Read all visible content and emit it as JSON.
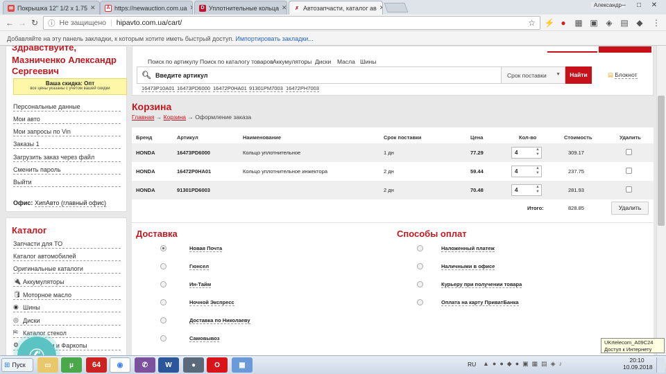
{
  "tabs": [
    {
      "title": "Покрышка 12\" 1/2 x 1.75",
      "icon": "mail-icon",
      "color": "#e04848"
    },
    {
      "title": "https://newauction.com.ua",
      "icon": "newauction-icon",
      "color": "#e03030"
    },
    {
      "title": "Уплотнительные кольца",
      "icon": "d-logo-icon",
      "color": "#c8102e"
    },
    {
      "title": "Автозапчасти, каталог ав",
      "icon": "hipavto-icon",
      "color": "#c8101a"
    }
  ],
  "window": {
    "user": "Александр"
  },
  "omnibox": {
    "security": "Не защищено",
    "url": "hipavto.com.ua/cart/"
  },
  "bookmarks_bar": {
    "text": "Добавляйте на эту панель закладки, к которым хотите иметь быстрый доступ.",
    "link": "Импортировать закладки..."
  },
  "sidebar": {
    "greeting": "Здравствуйте,",
    "user_name": "Мазниченко Александр Сергеевич",
    "discount_title": "Ваша скидка: Опт",
    "discount_note": "все цены указаны с учетом вашей скидки",
    "links": [
      "Персональные данные",
      "Мои авто",
      "Мои запросы по Vin",
      "Заказы 1",
      "Загрузить заказ через файл",
      "Сменить пароль",
      "Выйти"
    ],
    "office_label": "Офис:",
    "office_value": "ХипАвто (главный офис)"
  },
  "catalog": {
    "title": "Каталог",
    "items": [
      "Запчасти для ТО",
      "Каталог автомобилей",
      "Оригинальные каталоги",
      "Аккумуляторы",
      "Моторное масло",
      "Шины",
      "Диски",
      "Каталог стекол",
      "Глушители и Фаркопы"
    ]
  },
  "topnav": [
    "Поиск по артикулу",
    "Поиск по каталогу товаров",
    "Аккумуляторы",
    "Диски",
    "Масла",
    "Шины"
  ],
  "search": {
    "placeholder": "Введите артикул",
    "sort": "Срок поставки",
    "button": "Найти",
    "notepad": "Блокнот"
  },
  "recent_articles": [
    "16473P10A01",
    "16473PD6000",
    "16472P0HA01",
    "91301PM7003",
    "16472PH7003"
  ],
  "cart": {
    "title": "Корзина",
    "breadcrumb": {
      "home": "Главная",
      "sep1": "→",
      "cart": "Корзина",
      "sep2": "→",
      "current": "Оформление заказа"
    },
    "headers": {
      "brand": "Бренд",
      "article": "Артикул",
      "name": "Наименование",
      "delivery": "Срок поставки",
      "price": "Цена",
      "qty": "Кол-во",
      "cost": "Стоимость",
      "delete": "Удалить"
    },
    "rows": [
      {
        "brand": "HONDA",
        "article": "16473PD6000",
        "name": "Кольцо уплотнительное",
        "delivery": "1 дн",
        "price": "77.29",
        "qty": "4",
        "cost": "309.17"
      },
      {
        "brand": "HONDA",
        "article": "16472P0HA01",
        "name": "Кольцо уплотнительное инжектора",
        "delivery": "2 дн",
        "price": "59.44",
        "qty": "4",
        "cost": "237.75"
      },
      {
        "brand": "HONDA",
        "article": "91301PD6003",
        "name": "",
        "delivery": "2 дн",
        "price": "70.48",
        "qty": "4",
        "cost": "281.93"
      }
    ],
    "total_label": "Итого:",
    "total": "828.85",
    "delete_button": "Удалить"
  },
  "delivery": {
    "title": "Доставка",
    "options": [
      "Новая Почта",
      "Гюнсел",
      "Ин-Тайм",
      "Ночной Экспресс",
      "Доставка по Николаеву",
      "Самовывоз"
    ],
    "selected": 0
  },
  "payment": {
    "title": "Способы оплат",
    "options": [
      "Наложенный платеж",
      "Наличными в офисе",
      "Курьеру при получении товара",
      "Оплата на карту ПриватБанка"
    ]
  },
  "taskbar": {
    "start": "Пуск",
    "lang": "RU",
    "time": "20:10",
    "date": "10.09.2018"
  },
  "tooltip": {
    "line1": "UKrtelecom_A09C24",
    "line2": "Доступ к Интернету"
  }
}
